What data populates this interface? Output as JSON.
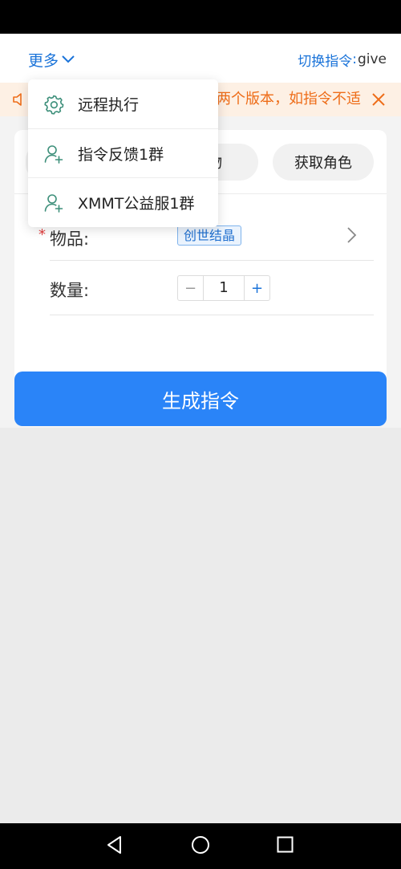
{
  "header": {
    "more_label": "更多",
    "switch_label": "切换指令",
    "switch_separator": ":",
    "switch_value": "give"
  },
  "notice": {
    "text": "两个版本，如指令不适"
  },
  "tabs": [
    {
      "label": ""
    },
    {
      "label": "物"
    },
    {
      "label": "获取角色"
    }
  ],
  "form": {
    "item_label": "物品:",
    "item_required_mark": "*",
    "item_value": "创世结晶",
    "qty_label": "数量:",
    "qty_value": "1",
    "minus": "−",
    "plus": "+"
  },
  "generate_label": "生成指令",
  "menu": {
    "items": [
      {
        "label": "远程执行",
        "icon": "settings-icon"
      },
      {
        "label": "指令反馈1群",
        "icon": "add-user-icon"
      },
      {
        "label": "XMMT公益服1群",
        "icon": "add-user-icon"
      }
    ]
  },
  "colors": {
    "accent": "#2a84f8",
    "link": "#1a73d9",
    "notice_text": "#ee6d19",
    "notice_bg": "#fdf0e4",
    "required": "#e23b3b"
  }
}
